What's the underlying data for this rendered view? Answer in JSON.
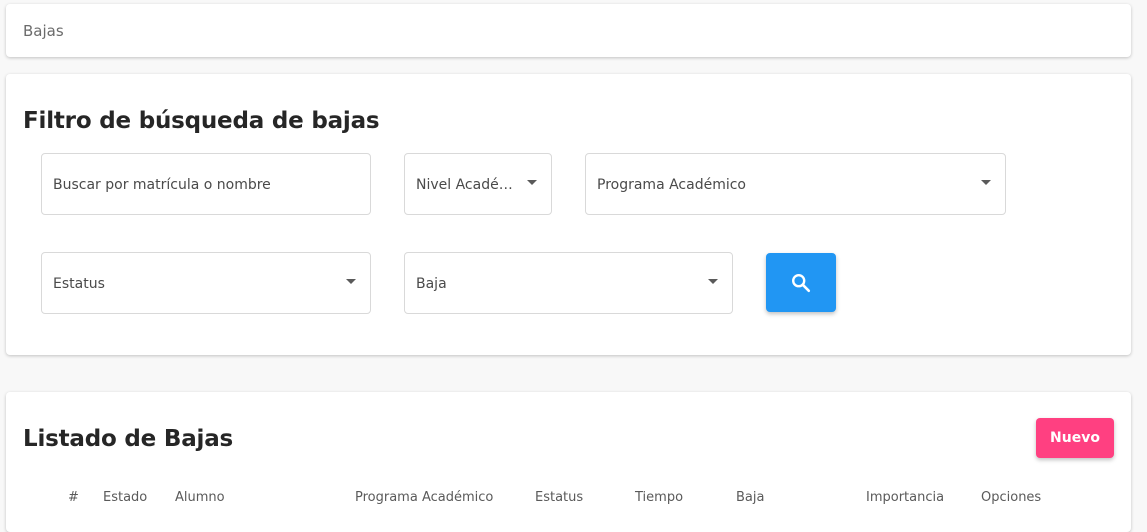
{
  "breadcrumb": {
    "label": "Bajas"
  },
  "filter": {
    "title": "Filtro de búsqueda de bajas",
    "search_placeholder": "Buscar por matrícula o nombre",
    "nivel_label": "Nivel Académico",
    "programa_label": "Programa Académico",
    "estatus_label": "Estatus",
    "baja_label": "Baja",
    "search_button_icon": "search-icon"
  },
  "list": {
    "title": "Listado de Bajas",
    "new_button_label": "Nuevo",
    "columns": [
      "#",
      "Estado",
      "Alumno",
      "Programa Académico",
      "Estatus",
      "Tiempo",
      "Baja",
      "Importancia",
      "Opciones"
    ]
  },
  "colors": {
    "primary": "#2196f3",
    "accent": "#ff4081",
    "background": "#f8f8f8"
  }
}
